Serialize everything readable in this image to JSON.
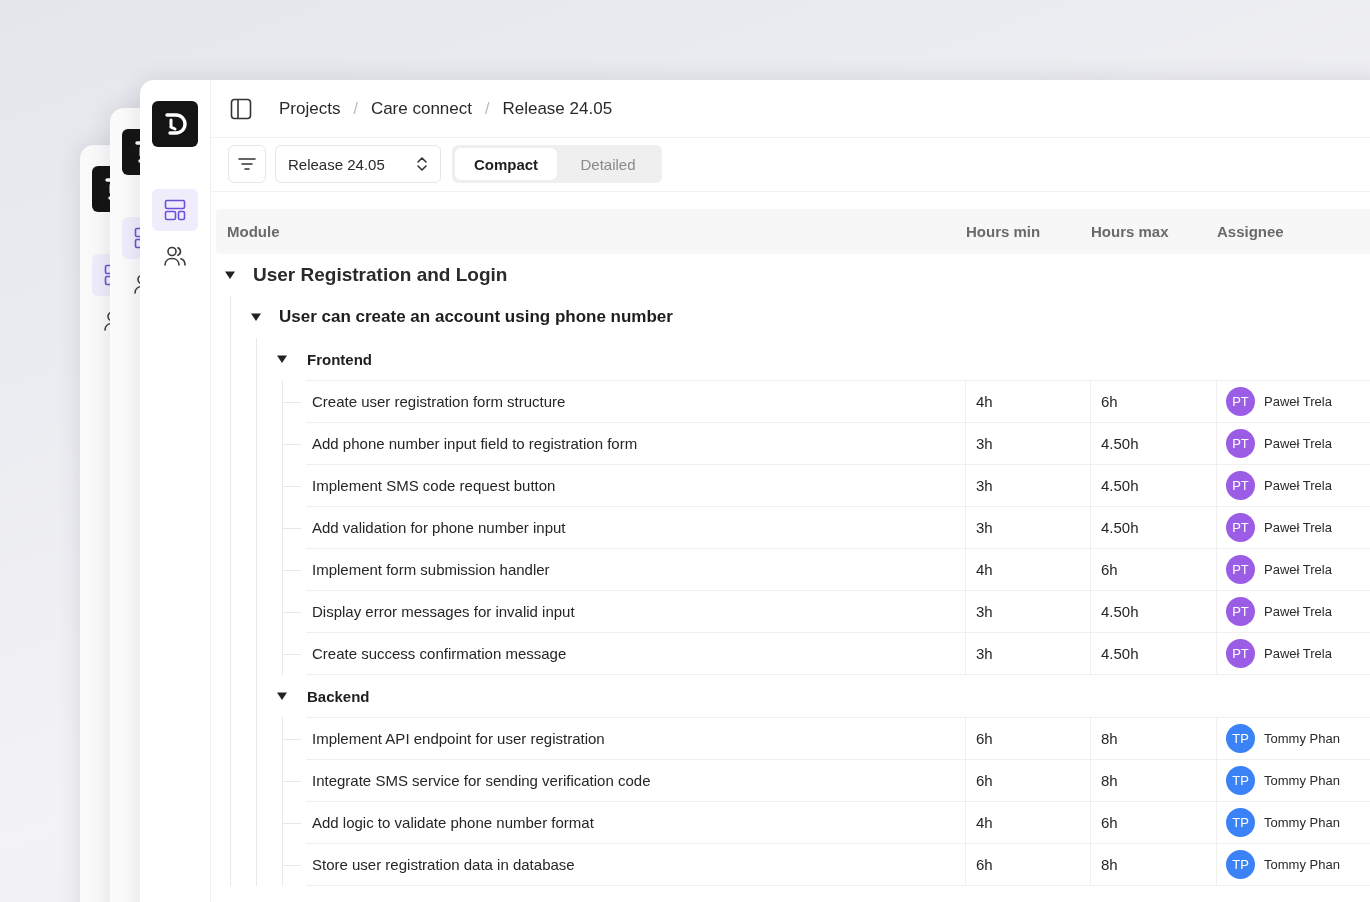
{
  "sidebar": {
    "items": [
      {
        "kind": "layout",
        "selected": true
      },
      {
        "kind": "people",
        "selected": false
      }
    ]
  },
  "breadcrumbs": [
    {
      "label": "Projects"
    },
    {
      "separator": "/",
      "label": "Care connect"
    },
    {
      "separator": "/",
      "label": "Release 24.05"
    }
  ],
  "toolbar": {
    "release_select": {
      "value": "Release 24.05"
    },
    "view_tabs": [
      {
        "label": "Compact",
        "selected": true
      },
      {
        "label": "Detailed",
        "selected": false
      }
    ]
  },
  "table": {
    "columns": [
      "Module",
      "Hours min",
      "Hours max",
      "Assignee"
    ],
    "rows": [
      {
        "title": "User Registration and Login",
        "expanded": true,
        "children": [
          {
            "title": "User can create an account using phone number",
            "expanded": true,
            "children": [
              {
                "title": "Frontend",
                "expanded": true,
                "children": [
                  {
                    "task": "Create user registration form structure",
                    "hours_min": "4h",
                    "hours_max": "6h",
                    "assignee": {
                      "initials": "PT",
                      "name": "Paweł Trela",
                      "color": "#9b5de5"
                    }
                  },
                  {
                    "task": "Add phone number input field to registration form",
                    "hours_min": "3h",
                    "hours_max": "4.50h",
                    "assignee": {
                      "initials": "PT",
                      "name": "Paweł Trela",
                      "color": "#9b5de5"
                    }
                  },
                  {
                    "task": "Implement SMS code request button",
                    "hours_min": "3h",
                    "hours_max": "4.50h",
                    "assignee": {
                      "initials": "PT",
                      "name": "Paweł Trela",
                      "color": "#9b5de5"
                    }
                  },
                  {
                    "task": "Add validation for phone number input",
                    "hours_min": "3h",
                    "hours_max": "4.50h",
                    "assignee": {
                      "initials": "PT",
                      "name": "Paweł Trela",
                      "color": "#9b5de5"
                    }
                  },
                  {
                    "task": "Implement form submission handler",
                    "hours_min": "4h",
                    "hours_max": "6h",
                    "assignee": {
                      "initials": "PT",
                      "name": "Paweł Trela",
                      "color": "#9b5de5"
                    }
                  },
                  {
                    "task": "Display error messages for invalid input",
                    "hours_min": "3h",
                    "hours_max": "4.50h",
                    "assignee": {
                      "initials": "PT",
                      "name": "Paweł Trela",
                      "color": "#9b5de5"
                    }
                  },
                  {
                    "task": "Create success confirmation message",
                    "hours_min": "3h",
                    "hours_max": "4.50h",
                    "assignee": {
                      "initials": "PT",
                      "name": "Paweł Trela",
                      "color": "#9b5de5"
                    }
                  }
                ]
              },
              {
                "title": "Backend",
                "expanded": true,
                "children": [
                  {
                    "task": "Implement API endpoint for user registration",
                    "hours_min": "6h",
                    "hours_max": "8h",
                    "assignee": {
                      "initials": "TP",
                      "name": "Tommy Phan",
                      "color": "#3b82f6"
                    }
                  },
                  {
                    "task": "Integrate SMS service for sending verification code",
                    "hours_min": "6h",
                    "hours_max": "8h",
                    "assignee": {
                      "initials": "TP",
                      "name": "Tommy Phan",
                      "color": "#3b82f6"
                    }
                  },
                  {
                    "task": "Add logic to validate phone number format",
                    "hours_min": "4h",
                    "hours_max": "6h",
                    "assignee": {
                      "initials": "TP",
                      "name": "Tommy Phan",
                      "color": "#3b82f6"
                    }
                  },
                  {
                    "task": "Store user registration data in database",
                    "hours_min": "6h",
                    "hours_max": "8h",
                    "assignee": {
                      "initials": "TP",
                      "name": "Tommy Phan",
                      "color": "#3b82f6"
                    }
                  }
                ]
              }
            ]
          }
        ]
      }
    ]
  }
}
